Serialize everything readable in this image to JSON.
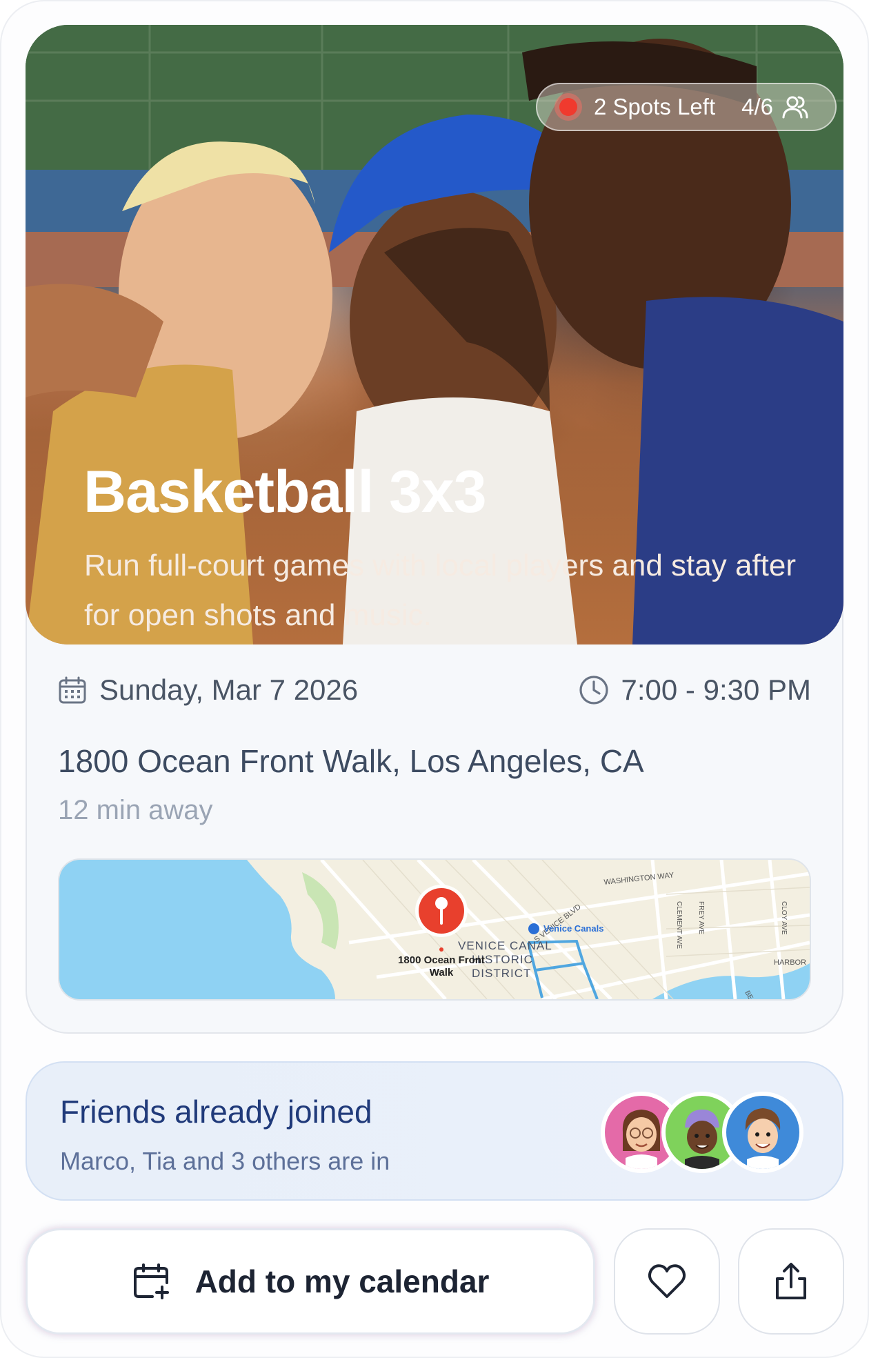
{
  "event": {
    "title": "Basketball 3x3",
    "description": "Run full-court games with local players and stay after for open shots and music.",
    "spots_left": "2 Spots Left",
    "capacity": "4/6",
    "date": "Sunday, Mar 7 2026",
    "time": "7:00 - 9:30 PM",
    "address": "1800 Ocean Front Walk, Los Angeles, CA",
    "distance": "12 min away"
  },
  "map": {
    "pin_label_line1": "1800 Ocean Front",
    "pin_label_line2": "Walk",
    "labels": {
      "washington_way": "WASHINGTON WAY",
      "s_venice_blvd": "S VENICE BLVD",
      "venice_canals": "Venice Canals",
      "district_1": "VENICE CANAL",
      "district_2": "HISTORIC",
      "district_3": "DISTRICT",
      "clement_ave": "CLEMENT AVE",
      "frey_ave": "FREY AVE",
      "cloy_ave": "CLOY AVE",
      "harbor": "HARBOR",
      "bea": "BEA"
    },
    "colors": {
      "water": "#8fd2f3",
      "land": "#f3efe1",
      "park": "#c9e5b4",
      "pin": "#e8402d"
    }
  },
  "friends": {
    "title": "Friends already joined",
    "subtitle": "Marco, Tia and 3 others are in",
    "avatars": [
      {
        "name": "avatar-pink",
        "bg": "#e46aa8"
      },
      {
        "name": "avatar-green",
        "bg": "#7fd25b"
      },
      {
        "name": "avatar-blue",
        "bg": "#3f8ad9"
      }
    ]
  },
  "actions": {
    "add_calendar": "Add to my calendar",
    "icons": [
      "calendar-plus-icon",
      "heart-icon",
      "share-icon"
    ]
  },
  "colors": {
    "accent": "#203a7a",
    "badge_dot": "#f03a2e"
  }
}
